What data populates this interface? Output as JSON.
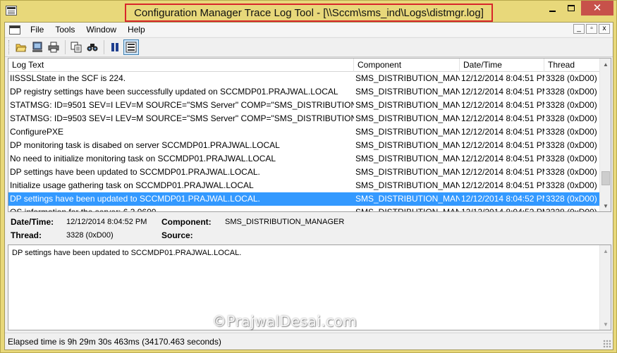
{
  "window": {
    "title": "Configuration Manager Trace Log Tool - [\\\\Sccm\\sms_ind\\Logs\\distmgr.log]",
    "close_glyph": "✕"
  },
  "menu": {
    "items": [
      "File",
      "Tools",
      "Window",
      "Help"
    ],
    "mdi_buttons": [
      "_",
      "▫",
      "x"
    ]
  },
  "toolbar": {
    "buttons": [
      "open-icon",
      "open-on-server-icon",
      "print-icon",
      "copy-icon",
      "find-icon",
      "pause-icon",
      "highlight-icon"
    ]
  },
  "log": {
    "columns": [
      "Log Text",
      "Component",
      "Date/Time",
      "Thread"
    ],
    "rows": [
      {
        "text": "IISSSLState in the SCF is 224.",
        "component": "SMS_DISTRIBUTION_MANA",
        "datetime": "12/12/2014 8:04:51 PM",
        "thread": "3328 (0xD00)"
      },
      {
        "text": "DP registry settings have been successfully updated on SCCMDP01.PRAJWAL.LOCAL",
        "component": "SMS_DISTRIBUTION_MANA",
        "datetime": "12/12/2014 8:04:51 PM",
        "thread": "3328 (0xD00)"
      },
      {
        "text": "STATMSG: ID=9501 SEV=I LEV=M SOURCE=\"SMS Server\" COMP=\"SMS_DISTRIBUTION_M...",
        "component": "SMS_DISTRIBUTION_MANA",
        "datetime": "12/12/2014 8:04:51 PM",
        "thread": "3328 (0xD00)"
      },
      {
        "text": "STATMSG: ID=9503 SEV=I LEV=M SOURCE=\"SMS Server\" COMP=\"SMS_DISTRIBUTION_M...",
        "component": "SMS_DISTRIBUTION_MANA",
        "datetime": "12/12/2014 8:04:51 PM",
        "thread": "3328 (0xD00)"
      },
      {
        "text": "ConfigurePXE",
        "component": "SMS_DISTRIBUTION_MANA",
        "datetime": "12/12/2014 8:04:51 PM",
        "thread": "3328 (0xD00)"
      },
      {
        "text": "DP monitoring task is disabed on server SCCMDP01.PRAJWAL.LOCAL",
        "component": "SMS_DISTRIBUTION_MANA",
        "datetime": "12/12/2014 8:04:51 PM",
        "thread": "3328 (0xD00)"
      },
      {
        "text": "No need to initialize monitoring task on SCCMDP01.PRAJWAL.LOCAL",
        "component": "SMS_DISTRIBUTION_MANA",
        "datetime": "12/12/2014 8:04:51 PM",
        "thread": "3328 (0xD00)"
      },
      {
        "text": "DP settings have been updated to SCCMDP01.PRAJWAL.LOCAL.",
        "component": "SMS_DISTRIBUTION_MANA",
        "datetime": "12/12/2014 8:04:51 PM",
        "thread": "3328 (0xD00)"
      },
      {
        "text": "Initialize usage gathering task on SCCMDP01.PRAJWAL.LOCAL",
        "component": "SMS_DISTRIBUTION_MANA",
        "datetime": "12/12/2014 8:04:51 PM",
        "thread": "3328 (0xD00)"
      },
      {
        "text": "DP settings have been updated to SCCMDP01.PRAJWAL.LOCAL.",
        "component": "SMS_DISTRIBUTION_MANA",
        "datetime": "12/12/2014 8:04:52 PM",
        "thread": "3328 (0xD00)",
        "selected": true
      },
      {
        "text": "OS information for the server: 6.3.9600",
        "component": "SMS_DISTRIBUTION_MANA",
        "datetime": "12/12/2014 8:04:52 PM",
        "thread": "3328 (0xD00)"
      }
    ]
  },
  "details": {
    "datetime_label": "Date/Time:",
    "datetime_value": "12/12/2014 8:04:52 PM",
    "component_label": "Component:",
    "component_value": "SMS_DISTRIBUTION_MANAGER",
    "thread_label": "Thread:",
    "thread_value": "3328 (0xD00)",
    "source_label": "Source:",
    "source_value": ""
  },
  "message": {
    "text": "DP settings have been updated to SCCMDP01.PRAJWAL.LOCAL."
  },
  "status": {
    "text": "Elapsed time is 9h 29m 30s 463ms (34170.463 seconds)"
  },
  "watermark": {
    "text": "©PrajwalDesai.com"
  },
  "colors": {
    "frame": "#e8d87a",
    "title_highlight": "#d8262b",
    "selection": "#3399ff",
    "close_button": "#c7514a"
  }
}
